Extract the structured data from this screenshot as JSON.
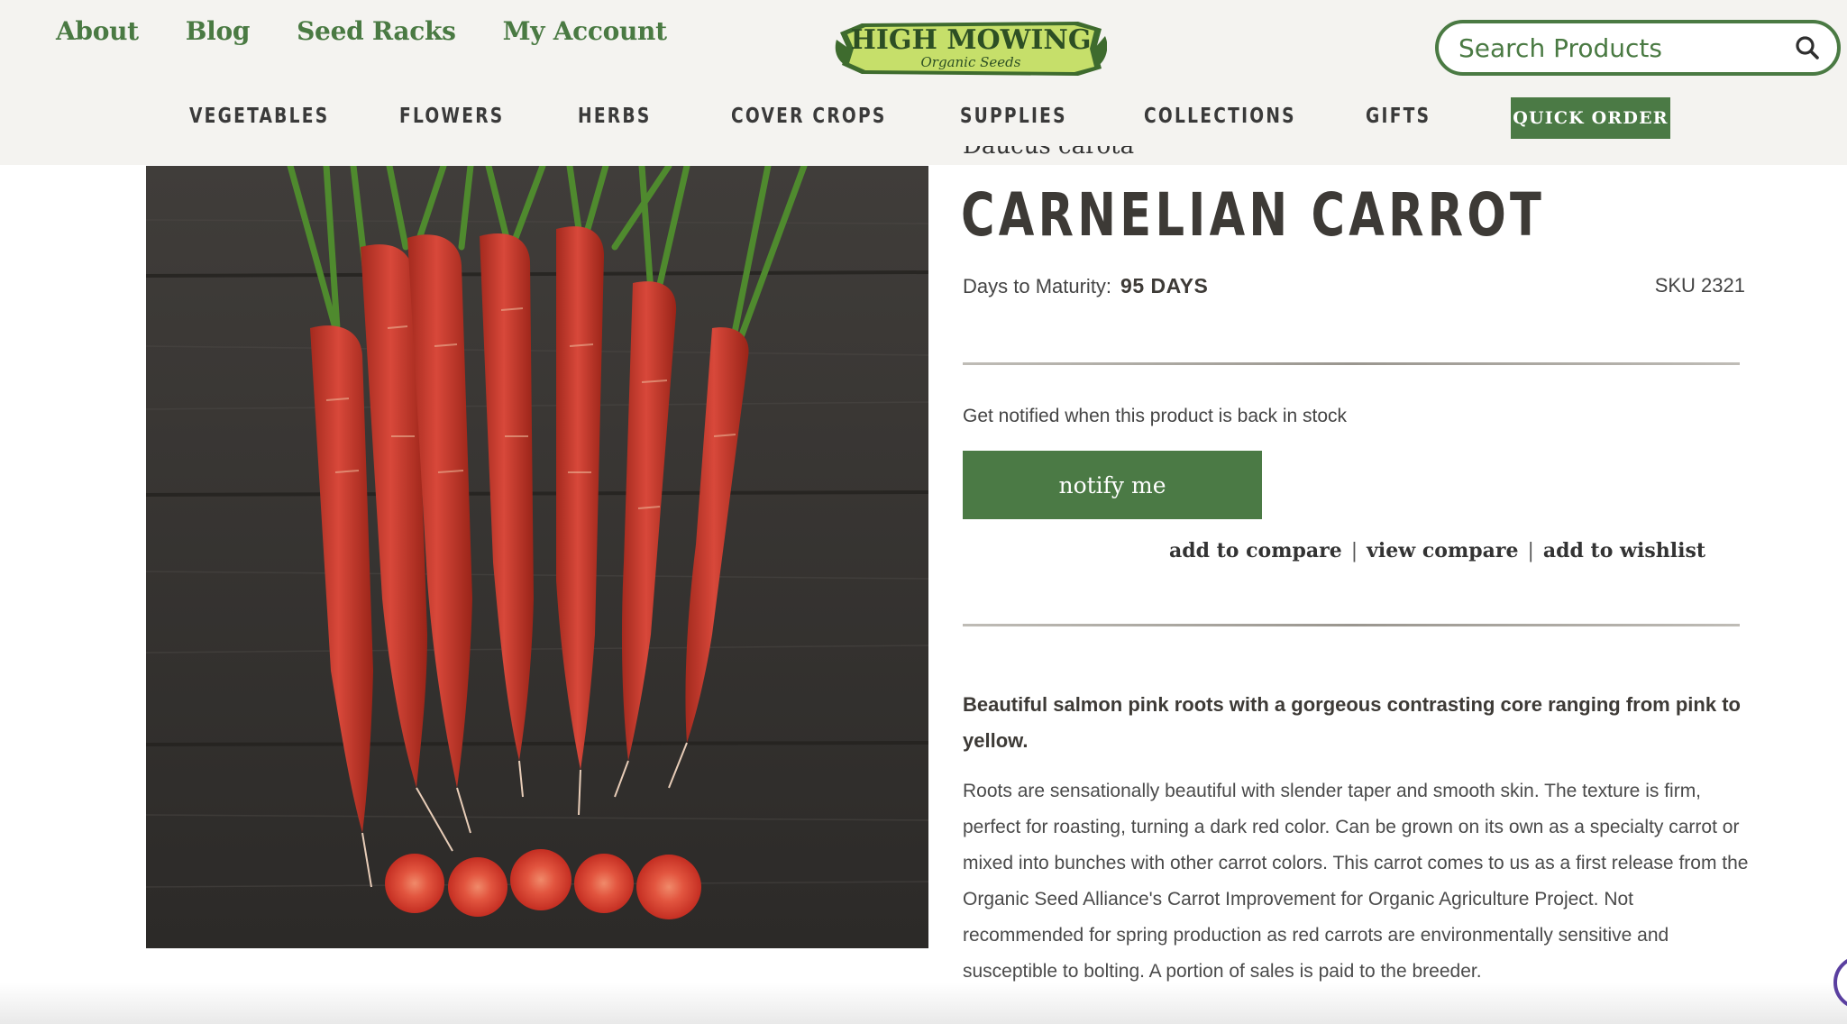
{
  "header": {
    "util_nav": [
      {
        "label": "About"
      },
      {
        "label": "Blog"
      },
      {
        "label": "Seed Racks"
      },
      {
        "label": "My Account"
      }
    ],
    "logo": {
      "line1": "HIGH MOWING",
      "line2": "Organic Seeds"
    },
    "search": {
      "placeholder": "Search Products",
      "icon": "search-icon"
    },
    "main_nav": [
      {
        "label": "VEGETABLES"
      },
      {
        "label": "FLOWERS"
      },
      {
        "label": "HERBS"
      },
      {
        "label": "COVER CROPS"
      },
      {
        "label": "SUPPLIES"
      },
      {
        "label": "COLLECTIONS"
      },
      {
        "label": "GIFTS"
      }
    ],
    "quick_order_label": "QUICK ORDER"
  },
  "product": {
    "latin_name": "Daucus carota",
    "title": "CARNELIAN CARROT",
    "maturity_label": "Days to Maturity:",
    "maturity_value": "95 DAYS",
    "sku": "SKU 2321",
    "notify_text": "Get notified when this product is back in stock",
    "notify_button": "notify me",
    "actions": {
      "compare": "add to compare",
      "view_compare": "view compare",
      "wishlist": "add to wishlist",
      "separator": "|"
    },
    "lead": "Beautiful salmon pink roots with a gorgeous contrasting core ranging from pink to yellow.",
    "description": "Roots are sensationally beautiful with slender taper and smooth skin. The texture is firm, perfect for roasting, turning a dark red color. Can be grown on its own as a specialty carrot or mixed into bunches with other carrot colors. This carrot comes to us as a first release from the Organic Seed Alliance's Carrot Improvement for Organic Agriculture Project. Not recommended for spring production as red carrots are environmentally sensitive and susceptible to bolting. A portion of sales is paid to the breeder."
  },
  "colors": {
    "brand_green": "#4b7a45",
    "link_green": "#4a7a43",
    "header_bg": "#f4f3f0",
    "title_text": "#3d3a36"
  }
}
